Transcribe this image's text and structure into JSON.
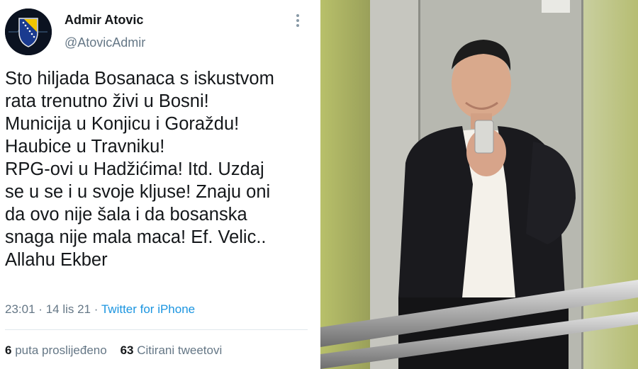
{
  "tweet": {
    "author_name": "Admir Atovic",
    "author_handle": "@AtovicAdmir",
    "text": "Sto hiljada Bosanaca s iskustvom\nrata trenutno živi u Bosni!\nMunicija u Konjicu i Goraždu!\nHaubice u Travniku!\nRPG-ovi u Hadžićima! Itd. Uzdaj\nse u se i u svoje kljuse! Znaju oni\nda ovo nije šala i da bosanska\nsnaga nije mala maca! Ef. Velic..\nAllahu Ekber",
    "time": "23:01",
    "date": "14 lis 21",
    "separator": "·",
    "source": "Twitter for iPhone",
    "retweets_count": "6",
    "retweets_label": "puta proslijeđeno",
    "quotes_count": "63",
    "quotes_label": "Citirani tweetovi"
  },
  "icons": {
    "avatar": "bosnian-flag-shield-icon",
    "more": "more-options-icon"
  },
  "photo": {
    "subject": "mirror-selfie-in-elevator"
  },
  "colors": {
    "text": "#14171a",
    "secondary": "#657786",
    "link": "#1b95e0"
  }
}
